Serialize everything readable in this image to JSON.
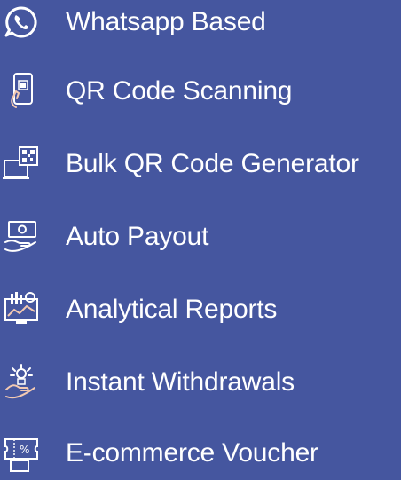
{
  "features": [
    {
      "label": "Whatsapp Based",
      "icon": "whatsapp-icon"
    },
    {
      "label": "QR Code Scanning",
      "icon": "phone-qr-scan-icon"
    },
    {
      "label": "Bulk QR Code Generator",
      "icon": "monitor-qr-icon"
    },
    {
      "label": "Auto Payout",
      "icon": "hand-cash-icon"
    },
    {
      "label": "Analytical Reports",
      "icon": "analytics-monitor-icon"
    },
    {
      "label": "Instant Withdrawals",
      "icon": "hand-coins-icon"
    },
    {
      "label": "E-commerce Voucher",
      "icon": "voucher-icon"
    }
  ],
  "colors": {
    "background": "#45569f",
    "text": "#ffffff",
    "icon_accent": "#f3c9b2"
  }
}
